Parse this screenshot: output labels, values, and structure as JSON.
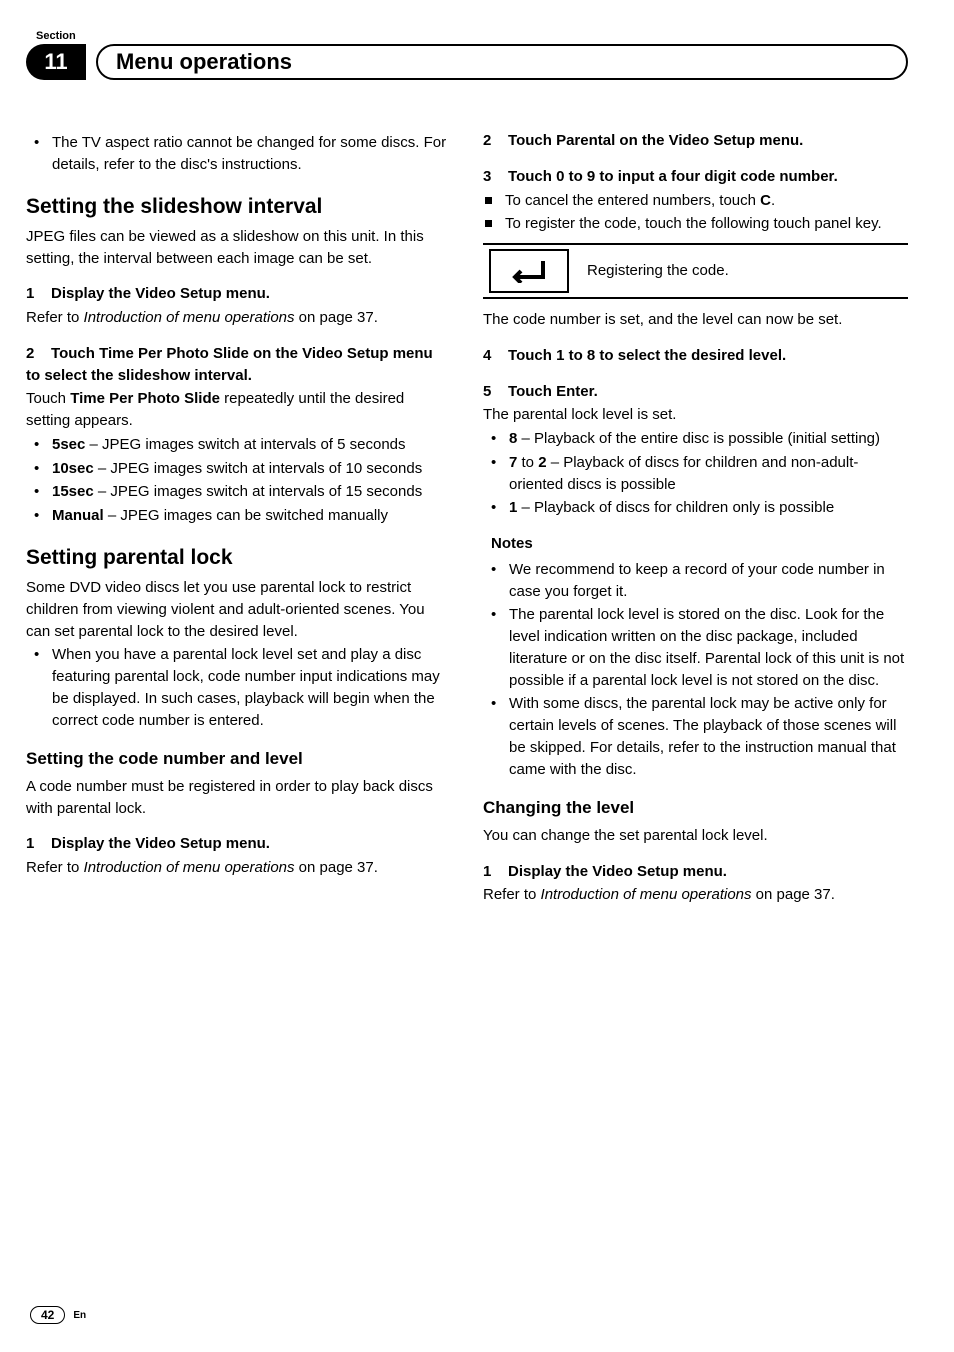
{
  "section_label": "Section",
  "chapter_num": "11",
  "chapter_title": "Menu operations",
  "col1": {
    "intro_bullet": "The TV aspect ratio cannot be changed for some discs. For details, refer to the disc's instructions.",
    "slideshow": {
      "heading": "Setting the slideshow interval",
      "intro": "JPEG files can be viewed as a slideshow on this unit. In this setting, the interval between each image can be set.",
      "step1_num": "1",
      "step1_title": "Display the Video Setup menu.",
      "step1_body_a": "Refer to ",
      "step1_body_i": "Introduction of menu operations",
      "step1_body_b": " on page 37.",
      "step2_num": "2",
      "step2_title": "Touch Time Per Photo Slide on the Video Setup menu to select the slideshow interval.",
      "step2_body_a": "Touch ",
      "step2_body_b": "Time Per Photo Slide",
      "step2_body_c": " repeatedly until the desired setting appears.",
      "opts": [
        {
          "k": "5sec",
          "v": " – JPEG images switch at intervals of 5 seconds"
        },
        {
          "k": "10sec",
          "v": " – JPEG images switch at intervals of 10 seconds"
        },
        {
          "k": "15sec",
          "v": " – JPEG images switch at intervals of 15 seconds"
        },
        {
          "k": "Manual",
          "v": " – JPEG images can be switched manually"
        }
      ]
    },
    "parental": {
      "heading": "Setting parental lock",
      "intro": "Some DVD video discs let you use parental lock to restrict children from viewing violent and adult-oriented scenes. You can set parental lock to the desired level.",
      "bullet": "When you have a parental lock level set and play a disc featuring parental lock, code number input indications may be displayed. In such cases, playback will begin when the correct code number is entered.",
      "sub_heading": "Setting the code number and level",
      "sub_intro": "A code number must be registered in order to play back discs with parental lock.",
      "step1_num": "1",
      "step1_title": "Display the Video Setup menu.",
      "step1_body_a": "Refer to ",
      "step1_body_i": "Introduction of menu operations",
      "step1_body_b": " on page 37."
    }
  },
  "col2": {
    "step2_num": "2",
    "step2_title": "Touch Parental on the Video Setup menu.",
    "step3_num": "3",
    "step3_title": "Touch 0 to 9 to input a four digit code number.",
    "step3_sq1_a": "To cancel the entered numbers, touch ",
    "step3_sq1_b": "C",
    "step3_sq1_c": ".",
    "step3_sq2": "To register the code, touch the following touch panel key.",
    "key_symbol": "↵",
    "key_desc": "Registering the code.",
    "after_key": "The code number is set, and the level can now be set.",
    "step4_num": "4",
    "step4_title": "Touch 1 to 8 to select the desired level.",
    "step5_num": "5",
    "step5_title": "Touch Enter.",
    "step5_body": "The parental lock level is set.",
    "levels": [
      {
        "k": "8",
        "v": " – Playback of the entire disc is possible (initial setting)"
      },
      {
        "k": "7",
        "mid": " to ",
        "k2": "2",
        "v": " – Playback of discs for children and non-adult-oriented discs is possible"
      },
      {
        "k": "1",
        "v": " – Playback of discs for children only is possible"
      }
    ],
    "notes_label": "Notes",
    "notes": [
      "We recommend to keep a record of your code number in case you forget it.",
      "The parental lock level is stored on the disc. Look for the level indication written on the disc package, included literature or on the disc itself. Parental lock of this unit is not possible if a parental lock level is not stored on the disc.",
      "With some discs, the parental lock may be active only for certain levels of scenes. The playback of those scenes will be skipped. For details, refer to the instruction manual that came with the disc."
    ],
    "changing": {
      "heading": "Changing the level",
      "intro": "You can change the set parental lock level.",
      "step1_num": "1",
      "step1_title": "Display the Video Setup menu.",
      "step1_body_a": "Refer to ",
      "step1_body_i": "Introduction of menu operations",
      "step1_body_b": " on page 37."
    }
  },
  "page_num": "42",
  "page_lang": "En"
}
